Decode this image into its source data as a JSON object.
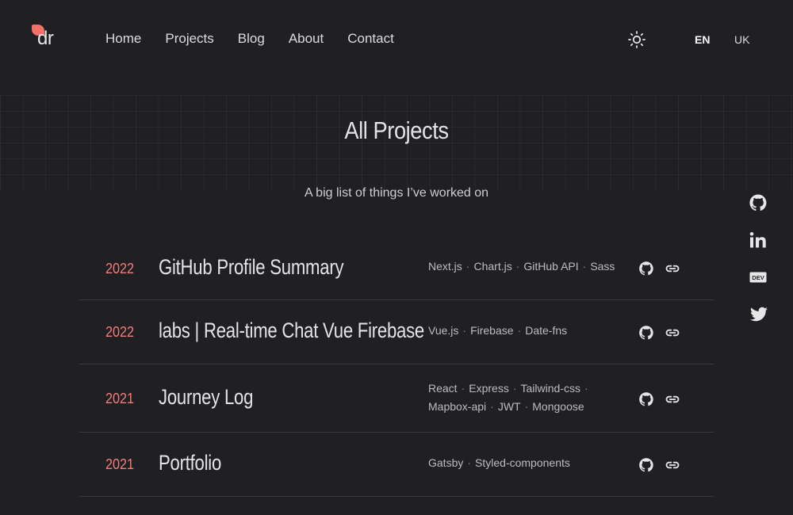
{
  "header": {
    "logo_text": "dr",
    "nav": [
      "Home",
      "Projects",
      "Blog",
      "About",
      "Contact"
    ],
    "languages": [
      "EN",
      "UK"
    ],
    "active_language": "EN",
    "theme_icon": "sun-icon"
  },
  "hero": {
    "title": "All Projects",
    "subtitle": "A big list of things I’ve worked on"
  },
  "social": [
    "github-icon",
    "linkedin-icon",
    "dev-icon",
    "twitter-icon"
  ],
  "social_dev_label": "DEV",
  "projects": [
    {
      "year": "2022",
      "title": "GitHub Profile Summary",
      "tech": [
        "Next.js",
        "Chart.js",
        "GitHub API",
        "Sass"
      ]
    },
    {
      "year": "2022",
      "title": "labs | Real-time Chat Vue Firebase",
      "tech": [
        "Vue.js",
        "Firebase",
        "Date-fns"
      ]
    },
    {
      "year": "2021",
      "title": "Journey Log",
      "tech": [
        "React",
        "Express",
        "Tailwind-css",
        "Mapbox-api",
        "JWT",
        "Mongoose"
      ]
    },
    {
      "year": "2021",
      "title": "Portfolio",
      "tech": [
        "Gatsby",
        "Styled-components"
      ]
    }
  ],
  "colors": {
    "background": "#201f23",
    "accent": "#f26f6a",
    "year": "#f37f7a",
    "text": "#e4e4e4"
  }
}
